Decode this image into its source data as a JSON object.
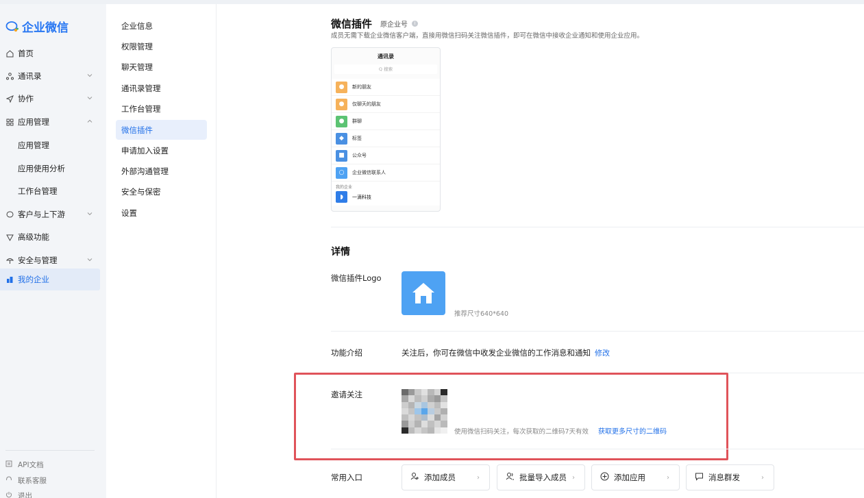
{
  "app": {
    "brand": "企业微信"
  },
  "nav": {
    "items": [
      {
        "label": "首页",
        "icon": "home-icon"
      },
      {
        "label": "通讯录",
        "icon": "contacts-icon"
      },
      {
        "label": "协作",
        "icon": "collab-icon"
      },
      {
        "label": "应用管理",
        "icon": "apps-icon"
      },
      {
        "label": "应用管理"
      },
      {
        "label": "应用使用分析"
      },
      {
        "label": "工作台管理"
      },
      {
        "label": "客户与上下游",
        "icon": "chat-bubble-icon"
      },
      {
        "label": "高级功能",
        "icon": "premium-icon"
      },
      {
        "label": "安全与管理",
        "icon": "umbrella-icon"
      },
      {
        "label": "我的企业",
        "icon": "company-icon"
      }
    ],
    "bottom": [
      {
        "label": "API文档"
      },
      {
        "label": "联系客服"
      },
      {
        "label": "退出"
      }
    ]
  },
  "subnav": {
    "items": [
      {
        "label": "企业信息"
      },
      {
        "label": "权限管理"
      },
      {
        "label": "聊天管理"
      },
      {
        "label": "通讯录管理"
      },
      {
        "label": "工作台管理"
      },
      {
        "label": "微信插件"
      },
      {
        "label": "申请加入设置"
      },
      {
        "label": "外部沟通管理"
      },
      {
        "label": "安全与保密"
      },
      {
        "label": "设置"
      }
    ]
  },
  "main": {
    "title": "微信插件",
    "orig": "原企业号",
    "desc": "成员无需下载企业微信客户端，直接用微信扫码关注微信插件，即可在微信中接收企业通知和使用企业应用。",
    "phone": {
      "title": "通讯录",
      "search": "Q 搜索",
      "rows": [
        {
          "label": "新的朋友",
          "color": "#f6b25b"
        },
        {
          "label": "仅聊天的朋友",
          "color": "#f6b25b"
        },
        {
          "label": "群聊",
          "color": "#5cc373"
        },
        {
          "label": "标签",
          "color": "#4a90e2"
        },
        {
          "label": "公众号",
          "color": "#4a90e2"
        },
        {
          "label": "企业微信联系人",
          "color": "#4ea2f3"
        }
      ],
      "my_company": "我的企业",
      "company": "一滴科技"
    },
    "details": {
      "title": "详情",
      "logo_label": "微信插件Logo",
      "logo_hint": "推荐尺寸640*640",
      "intro_label": "功能介绍",
      "intro_text": "关注后，你可在微信中收发企业微信的工作消息和通知",
      "intro_edit": "修改",
      "invite_label": "邀请关注",
      "invite_hint": "使用微信扫码关注，每次获取的二维码7天有效",
      "invite_link": "获取更多尺寸的二维码",
      "entry_label": "常用入口",
      "entries": [
        {
          "label": "添加成员"
        },
        {
          "label": "批量导入成员"
        },
        {
          "label": "添加应用"
        },
        {
          "label": "消息群发"
        }
      ]
    }
  }
}
